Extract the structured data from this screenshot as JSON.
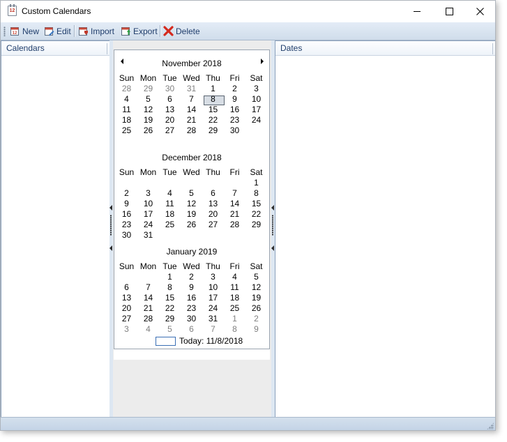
{
  "window": {
    "title": "Custom Calendars",
    "icon_text": "12"
  },
  "toolbar": {
    "buttons": [
      {
        "label": "New",
        "icon": "new-calendar-icon"
      },
      {
        "label": "Edit",
        "icon": "edit-calendar-icon"
      },
      {
        "label": "Import",
        "icon": "import-calendar-icon"
      },
      {
        "label": "Export",
        "icon": "export-calendar-icon"
      },
      {
        "label": "Delete",
        "icon": "delete-x-icon"
      }
    ]
  },
  "left_panel": {
    "header": "Calendars"
  },
  "right_panel": {
    "header": "Dates"
  },
  "calendar": {
    "weekdays": [
      "Sun",
      "Mon",
      "Tue",
      "Wed",
      "Thu",
      "Fri",
      "Sat"
    ],
    "selected_date": "8",
    "today_text": "Today: 11/8/2018",
    "months": [
      {
        "title": "November 2018",
        "weeks": [
          [
            {
              "d": "28",
              "o": true
            },
            {
              "d": "29",
              "o": true
            },
            {
              "d": "30",
              "o": true
            },
            {
              "d": "31",
              "o": true
            },
            {
              "d": "1"
            },
            {
              "d": "2"
            },
            {
              "d": "3"
            }
          ],
          [
            {
              "d": "4"
            },
            {
              "d": "5"
            },
            {
              "d": "6"
            },
            {
              "d": "7"
            },
            {
              "d": "8",
              "sel": true
            },
            {
              "d": "9"
            },
            {
              "d": "10"
            }
          ],
          [
            {
              "d": "11"
            },
            {
              "d": "12"
            },
            {
              "d": "13"
            },
            {
              "d": "14"
            },
            {
              "d": "15"
            },
            {
              "d": "16"
            },
            {
              "d": "17"
            }
          ],
          [
            {
              "d": "18"
            },
            {
              "d": "19"
            },
            {
              "d": "20"
            },
            {
              "d": "21"
            },
            {
              "d": "22"
            },
            {
              "d": "23"
            },
            {
              "d": "24"
            }
          ],
          [
            {
              "d": "25"
            },
            {
              "d": "26"
            },
            {
              "d": "27"
            },
            {
              "d": "28"
            },
            {
              "d": "29"
            },
            {
              "d": "30"
            },
            {
              "d": ""
            }
          ]
        ]
      },
      {
        "title": "December 2018",
        "weeks": [
          [
            {
              "d": ""
            },
            {
              "d": ""
            },
            {
              "d": ""
            },
            {
              "d": ""
            },
            {
              "d": ""
            },
            {
              "d": ""
            },
            {
              "d": "1"
            }
          ],
          [
            {
              "d": "2"
            },
            {
              "d": "3"
            },
            {
              "d": "4"
            },
            {
              "d": "5"
            },
            {
              "d": "6"
            },
            {
              "d": "7"
            },
            {
              "d": "8"
            }
          ],
          [
            {
              "d": "9"
            },
            {
              "d": "10"
            },
            {
              "d": "11"
            },
            {
              "d": "12"
            },
            {
              "d": "13"
            },
            {
              "d": "14"
            },
            {
              "d": "15"
            }
          ],
          [
            {
              "d": "16"
            },
            {
              "d": "17"
            },
            {
              "d": "18"
            },
            {
              "d": "19"
            },
            {
              "d": "20"
            },
            {
              "d": "21"
            },
            {
              "d": "22"
            }
          ],
          [
            {
              "d": "23"
            },
            {
              "d": "24"
            },
            {
              "d": "25"
            },
            {
              "d": "26"
            },
            {
              "d": "27"
            },
            {
              "d": "28"
            },
            {
              "d": "29"
            }
          ],
          [
            {
              "d": "30"
            },
            {
              "d": "31"
            },
            {
              "d": ""
            },
            {
              "d": ""
            },
            {
              "d": ""
            },
            {
              "d": ""
            },
            {
              "d": ""
            }
          ]
        ]
      },
      {
        "title": "January 2019",
        "weeks": [
          [
            {
              "d": ""
            },
            {
              "d": ""
            },
            {
              "d": "1"
            },
            {
              "d": "2"
            },
            {
              "d": "3"
            },
            {
              "d": "4"
            },
            {
              "d": "5"
            }
          ],
          [
            {
              "d": "6"
            },
            {
              "d": "7"
            },
            {
              "d": "8"
            },
            {
              "d": "9"
            },
            {
              "d": "10"
            },
            {
              "d": "11"
            },
            {
              "d": "12"
            }
          ],
          [
            {
              "d": "13"
            },
            {
              "d": "14"
            },
            {
              "d": "15"
            },
            {
              "d": "16"
            },
            {
              "d": "17"
            },
            {
              "d": "18"
            },
            {
              "d": "19"
            }
          ],
          [
            {
              "d": "20"
            },
            {
              "d": "21"
            },
            {
              "d": "22"
            },
            {
              "d": "23"
            },
            {
              "d": "24"
            },
            {
              "d": "25"
            },
            {
              "d": "26"
            }
          ],
          [
            {
              "d": "27"
            },
            {
              "d": "28"
            },
            {
              "d": "29"
            },
            {
              "d": "30"
            },
            {
              "d": "31"
            },
            {
              "d": "1",
              "o": true
            },
            {
              "d": "2",
              "o": true
            }
          ],
          [
            {
              "d": "3",
              "o": true
            },
            {
              "d": "4",
              "o": true
            },
            {
              "d": "5",
              "o": true
            },
            {
              "d": "6",
              "o": true
            },
            {
              "d": "7",
              "o": true
            },
            {
              "d": "8",
              "o": true
            },
            {
              "d": "9",
              "o": true
            }
          ]
        ]
      }
    ]
  },
  "colors": {
    "toolbar_text": "#1f3d6b",
    "delete_red": "#d42a1e",
    "today_border": "#3a6fb5",
    "other_month": "#808080"
  }
}
